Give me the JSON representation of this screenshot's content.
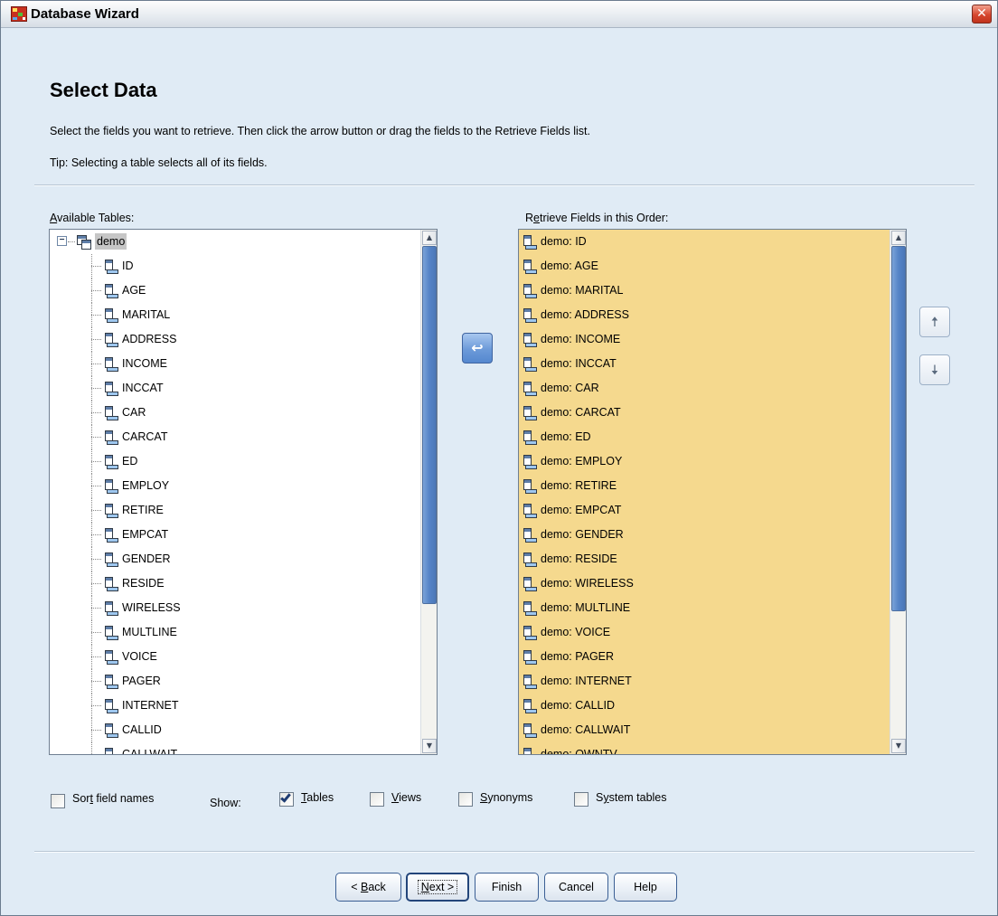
{
  "window": {
    "title": "Database Wizard",
    "close_glyph": "✕"
  },
  "page": {
    "heading": "Select Data",
    "instruction": "Select the fields you want to retrieve. Then click the arrow button or drag the fields to the Retrieve Fields list.",
    "tip": "Tip: Selecting a table selects all of its fields."
  },
  "available": {
    "label_mnemonic": "A",
    "label_rest": "vailable Tables:",
    "table_name": "demo",
    "fields": [
      "ID",
      "AGE",
      "MARITAL",
      "ADDRESS",
      "INCOME",
      "INCCAT",
      "CAR",
      "CARCAT",
      "ED",
      "EMPLOY",
      "RETIRE",
      "EMPCAT",
      "GENDER",
      "RESIDE",
      "WIRELESS",
      "MULTLINE",
      "VOICE",
      "PAGER",
      "INTERNET",
      "CALLID",
      "CALLWAIT"
    ]
  },
  "retrieve": {
    "label_pre": "R",
    "label_mnemonic": "e",
    "label_rest": "trieve Fields in this Order:",
    "fields": [
      "demo: ID",
      "demo: AGE",
      "demo: MARITAL",
      "demo: ADDRESS",
      "demo: INCOME",
      "demo: INCCAT",
      "demo: CAR",
      "demo: CARCAT",
      "demo: ED",
      "demo: EMPLOY",
      "demo: RETIRE",
      "demo: EMPCAT",
      "demo: GENDER",
      "demo: RESIDE",
      "demo: WIRELESS",
      "demo: MULTLINE",
      "demo: VOICE",
      "demo: PAGER",
      "demo: INTERNET",
      "demo: CALLID",
      "demo: CALLWAIT",
      "demo: OWNTV"
    ],
    "background": "#f5d98e"
  },
  "icons": {
    "move": "move-left-arrow-icon",
    "up": "arrow-up-icon",
    "down": "arrow-down-icon",
    "move_glyph": "↩",
    "up_glyph": "🠅",
    "down_glyph": "🠇",
    "scroll_up_glyph": "▲",
    "scroll_down_glyph": "▼",
    "collapse_glyph": "−"
  },
  "options": {
    "sort_pre": "Sor",
    "sort_mnemonic": "t",
    "sort_rest": " field names",
    "sort_checked": false,
    "show_label": "Show:",
    "tables_mnemonic": "T",
    "tables_rest": "ables",
    "tables_checked": true,
    "views_mnemonic": "V",
    "views_rest": "iews",
    "views_checked": false,
    "synonyms_mnemonic": "S",
    "synonyms_rest": "ynonyms",
    "synonyms_checked": false,
    "system_pre": "S",
    "system_mnemonic": "y",
    "system_rest": "stem tables",
    "system_checked": false
  },
  "buttons": {
    "back_pre": "< ",
    "back_mnemonic": "B",
    "back_rest": "ack",
    "next_mnemonic": "N",
    "next_rest": "ext >",
    "finish": "Finish",
    "cancel": "Cancel",
    "help": "Help"
  }
}
